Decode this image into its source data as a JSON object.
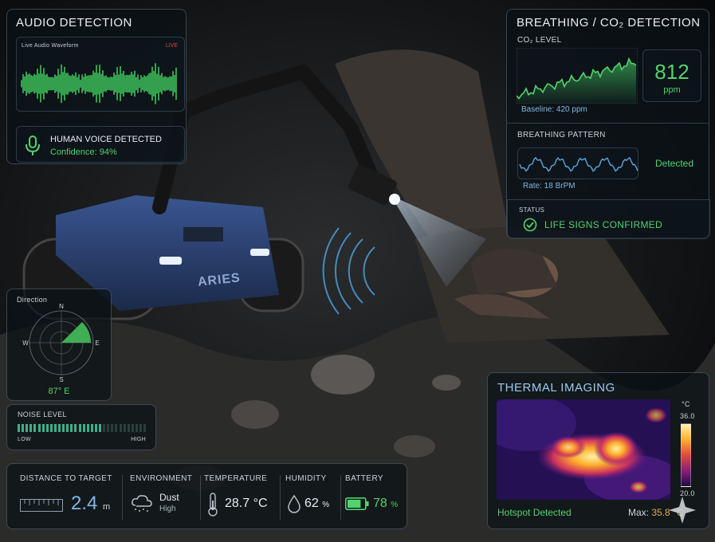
{
  "colors": {
    "accent_green": "#52d36b",
    "accent_blue": "#7fb8e6",
    "live_red": "#e0483e",
    "panel_bg": "#0a1016"
  },
  "robot": {
    "name": "ARIES"
  },
  "audio": {
    "title": "AUDIO DETECTION",
    "waveform_label": "Live Audio Waveform",
    "live_badge": "LIVE",
    "voice_status": "HUMAN VOICE DETECTED",
    "confidence": "Confidence: 94%",
    "icon": "microphone-icon"
  },
  "breathing": {
    "title": "BREATHING / CO₂ DETECTION",
    "co2_label": "CO₂ LEVEL",
    "co2_value": "812",
    "co2_unit": "ppm",
    "baseline": "Baseline: 420 ppm",
    "pattern_label": "BREATHING PATTERN",
    "pattern_status": "Detected",
    "rate": "Rate: 18 BrPM",
    "status_label": "STATUS",
    "status_text": "LIFE SIGNS CONFIRMED",
    "status_icon": "check-circle-icon"
  },
  "direction": {
    "label": "Direction",
    "n": "N",
    "e": "E",
    "s": "S",
    "w": "W",
    "value": "87° E"
  },
  "noise": {
    "label": "NOISE LEVEL",
    "low": "LOW",
    "high": "HIGH",
    "level_fraction": 0.67
  },
  "stats": {
    "distance_label": "DISTANCE TO TARGET",
    "distance_value": "2.4",
    "distance_unit": "m",
    "environment_label": "ENVIRONMENT",
    "environment_value": "Dust",
    "environment_sub": "High",
    "temperature_label": "TEMPERATURE",
    "temperature_value": "28.7 °C",
    "humidity_label": "HUMIDITY",
    "humidity_value": "62",
    "humidity_unit": "%",
    "battery_label": "BATTERY",
    "battery_value": "78",
    "battery_unit": "%",
    "battery_fraction": 0.78
  },
  "thermal": {
    "title": "THERMAL IMAGING",
    "scale_unit": "°C",
    "scale_max": "36.0",
    "scale_min": "20.0",
    "hotspot": "Hotspot Detected",
    "max_label": "Max:",
    "max_value": "35.8 °C"
  }
}
